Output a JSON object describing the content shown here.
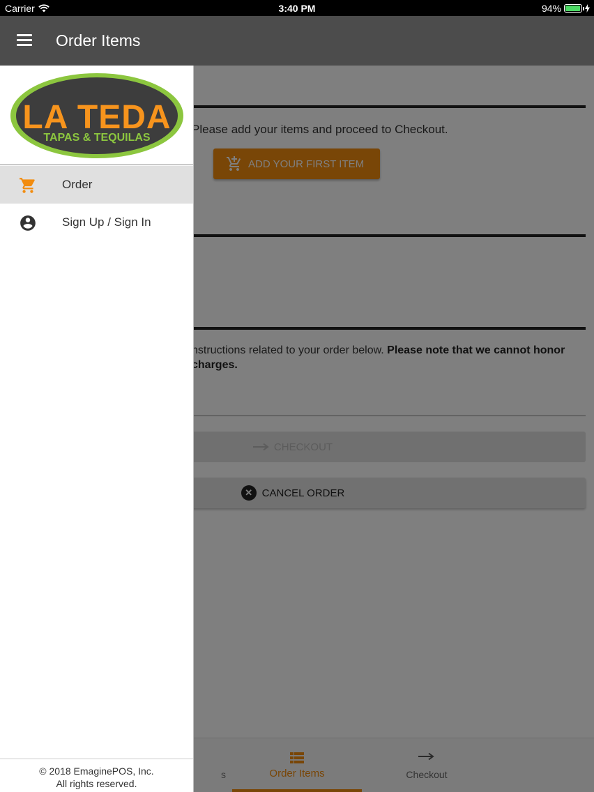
{
  "status_bar": {
    "carrier": "Carrier",
    "time": "3:40 PM",
    "battery_percent": "94%",
    "battery_level": 0.94,
    "battery_color": "#4cd964"
  },
  "app_bar": {
    "title": "Order Items",
    "menu_icon": "hamburger-menu-icon"
  },
  "main": {
    "empty_prompt": "Please add your items and proceed to Checkout.",
    "add_button_label": "ADD YOUR FIRST ITEM",
    "instructions_text": "nstructions related to your order below. ",
    "instructions_bold_line1": "Please note that we cannot honor",
    "instructions_bold_line2": "charges.",
    "checkout_label": "CHECKOUT",
    "cancel_label": "CANCEL ORDER"
  },
  "bottom_nav": {
    "items": [
      {
        "label": "s",
        "icon": "partial-icon"
      },
      {
        "label": "Order Items",
        "icon": "list-icon",
        "active": true
      },
      {
        "label": "Checkout",
        "icon": "arrow-right-icon"
      }
    ],
    "accent_color": "#f28c0f"
  },
  "drawer": {
    "logo": {
      "line1": "LA TEDA",
      "line2": "TAPAS & TEQUILAS"
    },
    "items": [
      {
        "label": "Order",
        "icon": "cart-icon",
        "selected": true
      },
      {
        "label": "Sign Up / Sign In",
        "icon": "account-circle-icon"
      }
    ],
    "footer_line1": "© 2018  EmaginePOS, Inc.",
    "footer_line2": "All rights reserved."
  }
}
